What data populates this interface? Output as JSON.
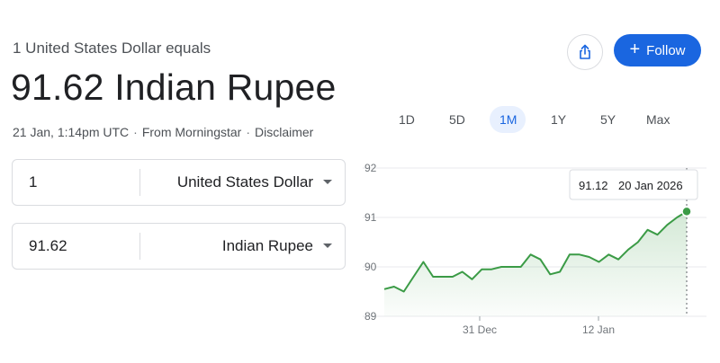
{
  "header": {
    "subtitle": "1 United States Dollar equals",
    "headline": "91.62 Indian Rupee",
    "timestamp": "21 Jan, 1:14pm UTC",
    "source": "From Morningstar",
    "disclaimer": "Disclaimer"
  },
  "actions": {
    "share_icon": "share-icon",
    "follow_label": "Follow"
  },
  "converter": {
    "from": {
      "amount": "1",
      "currency": "United States Dollar"
    },
    "to": {
      "amount": "91.62",
      "currency": "Indian Rupee"
    }
  },
  "range_tabs": {
    "items": [
      "1D",
      "5D",
      "1M",
      "1Y",
      "5Y",
      "Max"
    ],
    "selected": "1M"
  },
  "colors": {
    "accent": "#1a66e0",
    "line": "#3b9b46",
    "area": "#e6f4e8"
  },
  "chart_data": {
    "type": "line",
    "y_ticks": [
      "92",
      "91",
      "90",
      "89"
    ],
    "x_ticks": [
      "31 Dec",
      "12 Jan"
    ],
    "ylim": [
      89,
      92
    ],
    "grid": true,
    "values": [
      89.55,
      89.6,
      89.5,
      89.8,
      90.1,
      89.8,
      89.8,
      89.8,
      89.9,
      89.75,
      89.95,
      89.95,
      90.0,
      90.0,
      90.0,
      90.25,
      90.15,
      89.85,
      89.9,
      90.25,
      90.25,
      90.2,
      90.1,
      90.25,
      90.15,
      90.35,
      90.5,
      90.75,
      90.65,
      90.85,
      91.0,
      91.12
    ],
    "tooltip": {
      "value": "91.12",
      "date": "20 Jan 2026"
    }
  }
}
